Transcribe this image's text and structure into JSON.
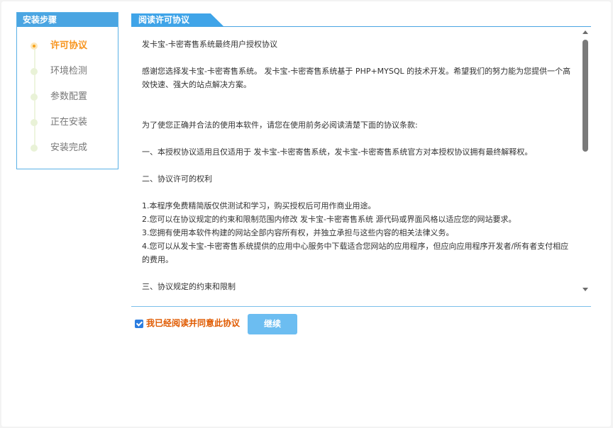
{
  "sidebar": {
    "title": "安装步骤",
    "steps": [
      {
        "label": "许可协议",
        "active": true
      },
      {
        "label": "环境检测",
        "active": false
      },
      {
        "label": "参数配置",
        "active": false
      },
      {
        "label": "正在安装",
        "active": false
      },
      {
        "label": "安装完成",
        "active": false
      }
    ]
  },
  "main": {
    "tab_label": "阅读许可协议",
    "agreement": {
      "title": "发卡宝-卡密寄售系统最终用户授权协议",
      "intro": "感谢您选择发卡宝-卡密寄售系统。 发卡宝-卡密寄售系统基于 PHP+MYSQL 的技术开发。希望我们的努力能为您提供一个高效快速、强大的站点解决方案。",
      "notice": "为了使您正确并合法的使用本软件，请您在使用前务必阅读清楚下面的协议条款:",
      "section1": "一、本授权协议适用且仅适用于 发卡宝-卡密寄售系统，发卡宝-卡密寄售系统官方对本授权协议拥有最终解释权。",
      "section2_title": "二、协议许可的权利",
      "items": [
        "1.本程序免费精简版仅供测试和学习，购买授权后可用作商业用途。",
        "2.您可以在协议规定的约束和限制范围内修改 发卡宝-卡密寄售系统 源代码或界面风格以适应您的网站要求。",
        "3.您拥有使用本软件构建的网站全部内容所有权，并独立承担与这些内容的相关法律义务。",
        "4.您可以从发卡宝-卡密寄售系统提供的应用中心服务中下载适合您网站的应用程序，但应向应用程序开发者/所有者支付相应的费用。"
      ],
      "section3_title": "三、协议规定的约束和限制"
    },
    "agree_label": "我已经阅读并同意此协议",
    "agree_checked": true,
    "continue_label": "继续"
  },
  "colors": {
    "accent": "#3fa4e8",
    "active_step": "#f7941d",
    "agree_text": "#e05a00",
    "button": "#6cbdf1"
  }
}
